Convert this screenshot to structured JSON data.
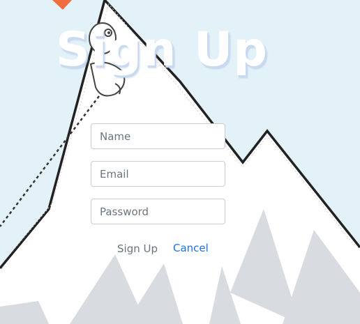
{
  "page": {
    "title": "Sign Up"
  },
  "form": {
    "name_placeholder": "Name",
    "email_placeholder": "Email",
    "password_placeholder": "Password",
    "submit_label": "Sign Up",
    "cancel_label": "Cancel"
  },
  "colors": {
    "sky": "#e3f2f8",
    "mountain_fill": "#ffffff",
    "mountain_outline": "#222222",
    "mountain_shadow": "#d8dbe0",
    "flag": "#f26d3d",
    "link": "#1a73e8",
    "muted_text": "#6c757d"
  },
  "icons": [
    "flag-icon",
    "climber-illustration"
  ]
}
